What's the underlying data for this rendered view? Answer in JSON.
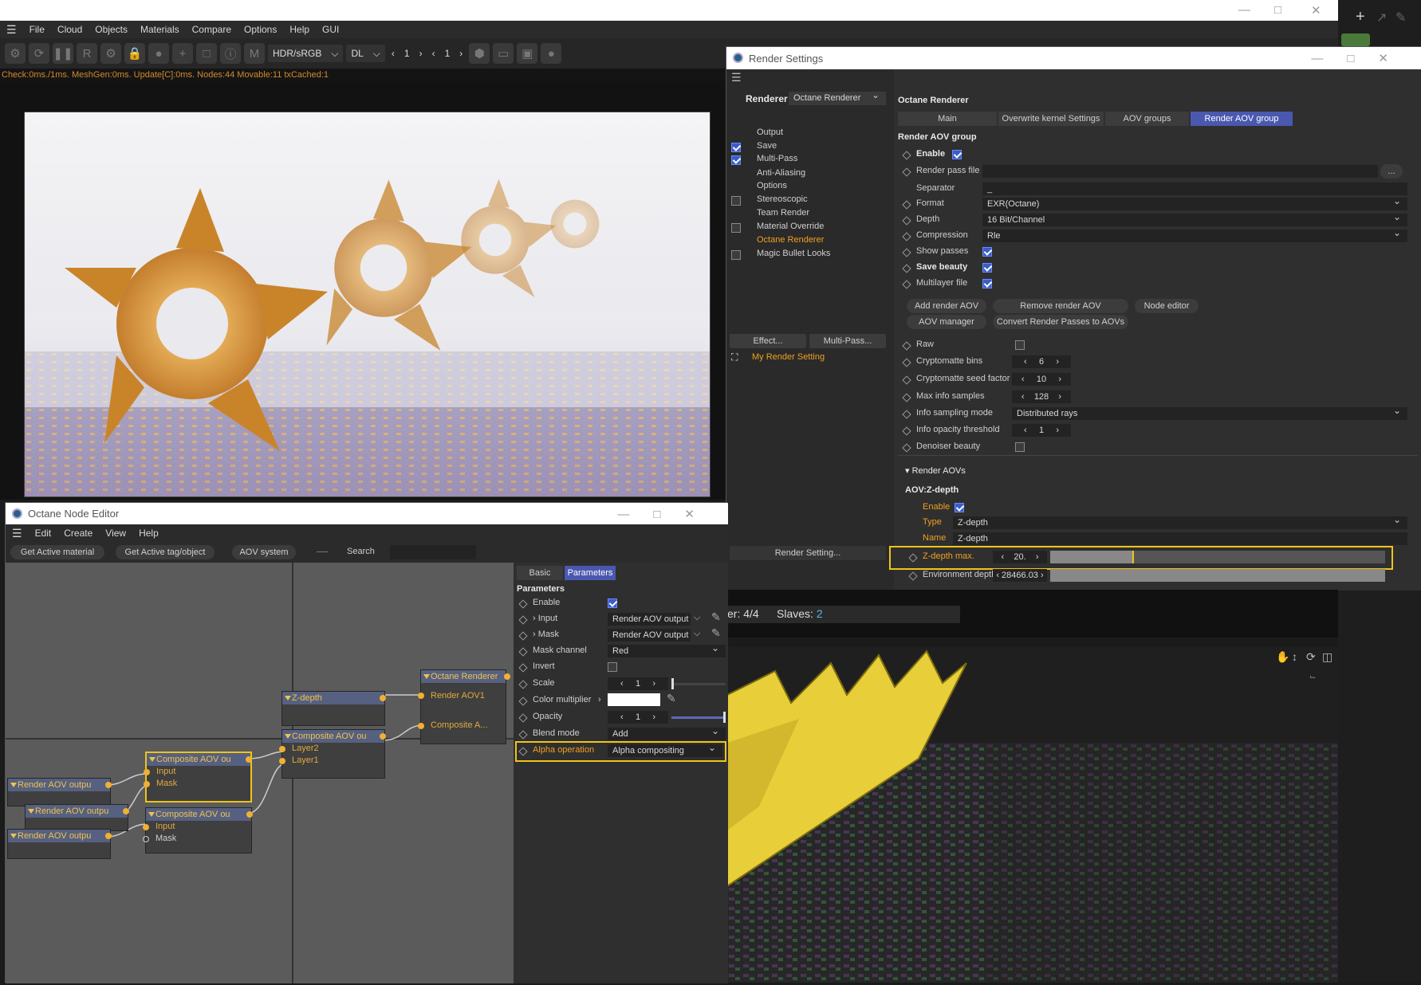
{
  "main_menu": [
    "File",
    "Cloud",
    "Objects",
    "Materials",
    "Compare",
    "Options",
    "Help",
    "GUI"
  ],
  "toolbar": {
    "colorspace": "HDR/sRGB",
    "mode": "DL",
    "frame_a": "1",
    "frame_b": "1"
  },
  "status_text": "Check:0ms./1ms. MeshGen:0ms. Update[C]:0ms. Nodes:44 Movable:11 txCached:1",
  "render_settings": {
    "title": "Render Settings",
    "renderer_label": "Renderer",
    "renderer_value": "Octane Renderer",
    "tree": [
      {
        "label": "Output",
        "check": "none",
        "active": false
      },
      {
        "label": "Save",
        "check": "on",
        "active": false
      },
      {
        "label": "Multi-Pass",
        "check": "on",
        "active": false
      },
      {
        "label": "Anti-Aliasing",
        "check": "none",
        "active": false
      },
      {
        "label": "Options",
        "check": "none",
        "active": false
      },
      {
        "label": "Stereoscopic",
        "check": "off",
        "active": false
      },
      {
        "label": "Team Render",
        "check": "none",
        "active": false
      },
      {
        "label": "Material Override",
        "check": "off",
        "active": false
      },
      {
        "label": "Octane Renderer",
        "check": "none",
        "active": true
      },
      {
        "label": "Magic Bullet Looks",
        "check": "off",
        "active": false
      }
    ],
    "effect_btn": "Effect...",
    "multipass_btn": "Multi-Pass...",
    "my_setting": "My Render Setting",
    "render_setting_btn": "Render Setting...",
    "section_title": "Octane Renderer",
    "tabs": [
      "Main",
      "Overwrite kernel Settings",
      "AOV groups",
      "Render AOV group"
    ],
    "group_title": "Render AOV group",
    "enable_label": "Enable",
    "render_pass_file_label": "Render pass file",
    "render_pass_file_btn": "...",
    "separator_label": "Separator",
    "separator_value": "_",
    "format_label": "Format",
    "format_value": "EXR(Octane)",
    "depth_label": "Depth",
    "depth_value": "16 Bit/Channel",
    "compression_label": "Compression",
    "compression_value": "Rle",
    "show_passes_label": "Show passes",
    "save_beauty_label": "Save beauty",
    "multilayer_label": "Multilayer file",
    "buttons": [
      "Add render AOV",
      "Remove render AOV",
      "Node editor",
      "AOV manager",
      "Convert Render Passes to AOVs"
    ],
    "raw_label": "Raw",
    "crypto_bins_label": "Cryptomatte bins",
    "crypto_bins": "6",
    "crypto_seed_label": "Cryptomatte seed factor",
    "crypto_seed": "10",
    "max_info_label": "Max info samples",
    "max_info": "128",
    "info_mode_label": "Info sampling mode",
    "info_mode": "Distributed rays",
    "info_opacity_label": "Info opacity threshold",
    "info_opacity": "1",
    "denoiser_label": "Denoiser beauty",
    "render_aovs": "Render AOVs",
    "aov_title": "AOV:Z-depth",
    "aov_enable": "Enable",
    "aov_type_label": "Type",
    "aov_type": "Z-depth",
    "aov_name_label": "Name",
    "aov_name": "Z-depth",
    "zmax_label": "Z-depth max.",
    "zmax": "20.",
    "zmax_fill": 0.25,
    "envdepth_label": "Environment depth",
    "envdepth": "28466.03"
  },
  "team": {
    "render_text": "er: 4/4",
    "slaves_label": "Slaves:",
    "slaves": "2"
  },
  "node_editor": {
    "title": "Octane Node Editor",
    "menu": [
      "Edit",
      "Create",
      "View",
      "Help"
    ],
    "tools": [
      "Get Active material",
      "Get Active tag/object",
      "AOV system"
    ],
    "search_label": "Search",
    "nodes": {
      "zdepth": "Z-depth",
      "octane": "Octane Renderer",
      "octane_pins": [
        "Render AOV1",
        "Composite A..."
      ],
      "comp_main": "Composite AOV ou",
      "comp_main_pins": [
        "Layer2",
        "Layer1"
      ],
      "comp_hl": "Composite AOV ou",
      "comp_hl_pins": [
        "Input",
        "Mask"
      ],
      "comp_b": "Composite AOV ou",
      "comp_b_pins": [
        "Input",
        "Mask"
      ],
      "rao1": "Render AOV outpu",
      "rao2": "Render AOV outpu",
      "rao3": "Render AOV outpu"
    },
    "param_tabs": [
      "Basic",
      "Parameters"
    ],
    "params_title": "Parameters",
    "params": {
      "enable": "Enable",
      "input": "Input",
      "input_val": "Render AOV output",
      "mask": "Mask",
      "mask_val": "Render AOV output",
      "mask_channel": "Mask channel",
      "mask_channel_val": "Red",
      "invert": "Invert",
      "scale": "Scale",
      "scale_val": "1",
      "color_mult": "Color multiplier",
      "opacity": "Opacity",
      "opacity_val": "1",
      "blend": "Blend mode",
      "blend_val": "Add",
      "alpha": "Alpha operation",
      "alpha_val": "Alpha compositing"
    }
  },
  "colors": {
    "accent": "#4a58b0",
    "highlight": "#f0c419",
    "orange": "#f0b030"
  }
}
